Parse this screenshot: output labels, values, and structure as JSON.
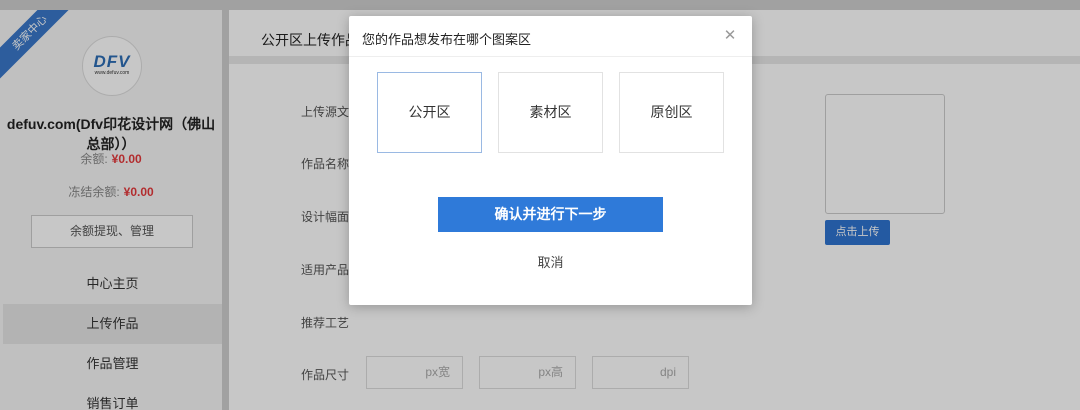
{
  "sidebar": {
    "ribbon_text": "卖家中心",
    "logo_text": "DFV",
    "logo_sub": "www.defuv.com",
    "shop_name": "defuv.com(Dfv印花设计网（佛山总部））",
    "balance_label": "余额:",
    "balance_value": "¥0.00",
    "frozen_label": "冻结余额:",
    "frozen_value": "¥0.00",
    "withdraw_label": "余额提现、管理",
    "nav": [
      {
        "label": "中心主页"
      },
      {
        "label": "上传作品"
      },
      {
        "label": "作品管理"
      },
      {
        "label": "销售订单"
      }
    ]
  },
  "main": {
    "title": "公开区上传作品",
    "form_labels": [
      "上传源文件",
      "作品名称",
      "设计幅面",
      "适用产品",
      "推荐工艺",
      "作品尺寸"
    ],
    "upload_button": "点击上传",
    "size_placeholders": [
      "px宽",
      "px高",
      "dpi"
    ]
  },
  "modal": {
    "title": "您的作品想发布在哪个图案区",
    "options": [
      {
        "label": "公开区"
      },
      {
        "label": "素材区"
      },
      {
        "label": "原创区"
      }
    ],
    "close_icon": "close-icon",
    "confirm_label": "确认并进行下一步",
    "cancel_label": "取消"
  },
  "colors": {
    "accent": "#2f7ad9",
    "price": "#e4393c",
    "ribbon": "#3a78c9"
  }
}
